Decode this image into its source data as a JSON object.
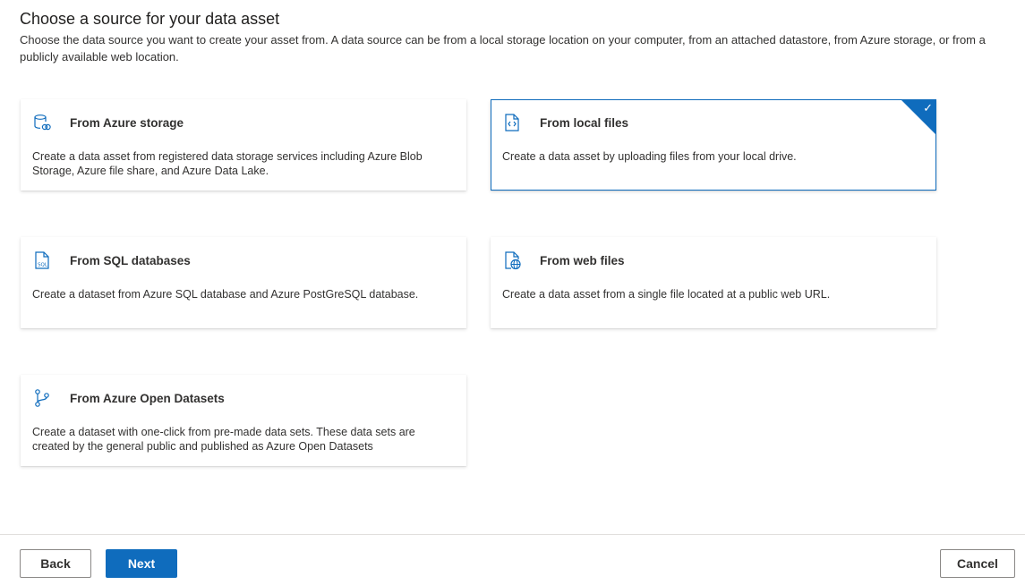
{
  "header": {
    "title": "Choose a source for your data asset",
    "description": "Choose the data source you want to create your asset from. A data source can be from a local storage location on your computer, from an attached datastore, from Azure storage, or from a publicly available web location."
  },
  "sources": [
    {
      "icon": "storage-icon",
      "title": "From Azure storage",
      "description": "Create a data asset from registered data storage services including Azure Blob Storage, Azure file share, and Azure Data Lake.",
      "selected": false
    },
    {
      "icon": "code-file-icon",
      "title": "From local files",
      "description": "Create a data asset by uploading files from your local drive.",
      "selected": true
    },
    {
      "icon": "sql-file-icon",
      "title": "From SQL databases",
      "description": "Create a dataset from Azure SQL database and Azure PostGreSQL database.",
      "selected": false
    },
    {
      "icon": "web-file-icon",
      "title": "From web files",
      "description": "Create a data asset from a single file located at a public web URL.",
      "selected": false
    },
    {
      "icon": "branch-icon",
      "title": "From Azure Open Datasets",
      "description": "Create a dataset with one-click from pre-made data sets. These data sets are created by the general public and published as Azure Open Datasets",
      "selected": false
    }
  ],
  "footer": {
    "back_label": "Back",
    "next_label": "Next",
    "cancel_label": "Cancel"
  },
  "colors": {
    "accent": "#0f6cbd",
    "border": "#8a8886",
    "text": "#323130"
  }
}
